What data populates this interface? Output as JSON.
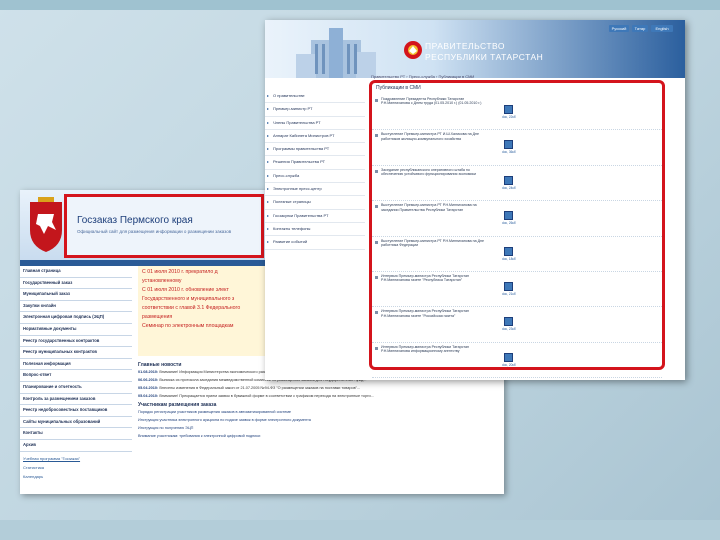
{
  "perm_site": {
    "title": "Госзаказ Пермского края",
    "subtitle": "Официальный сайт для размещения информации о размещении заказов",
    "sidebar": [
      "Главная страница",
      "Государственный заказ",
      "Муниципальный заказ",
      "Закупки онлайн",
      "Электронная цифровая подпись (ЭЦП)",
      "Нормативные документы",
      "Реестр государственных контрактов",
      "Реестр муниципальных контрактов",
      "Полезная информация",
      "Вопрос-ответ",
      "Планирование и отчетность",
      "Контроль за размещением заказов",
      "Реестр недобросовестных поставщиков",
      "Сайты муниципальных образований",
      "Контакты",
      "Архив"
    ],
    "side_extra": [
      "Учебная программа \"Госзаказ\"",
      "Статистика",
      "Календарь"
    ],
    "banner_lines": [
      "С 01 июля 2010 г. прекратило д",
      "установленному",
      "С 01 июля 2010 г. обновление элект",
      "Государственного и муниципального з",
      "соответствии с главой 3.1 Федерального",
      "размещения",
      "Семинар по электронным площадкам"
    ],
    "sec_news": "Главные новости",
    "news": [
      {
        "date": "01.08.2010:",
        "text": "Внимание! Информация Министерства экономического развития Пермского края о переходе на электронную форму размещения заказов..."
      },
      {
        "date": "06.06.2010:",
        "text": "Выписка из протокола заседания межведомственной комиссии по размещению заказов для государственных нужд..."
      },
      {
        "date": "05.04.2010:",
        "text": "Внесены изменения в Федеральный закон от 21.07.2005 №94-ФЗ \"О размещении заказов на поставки товаров\"..."
      },
      {
        "date": "05.04.2010:",
        "text": "Внимание! Прекращается прием заявок в бумажной форме в соответствии с графиком перехода на электронные торги..."
      }
    ],
    "sec_participants": "Участникам размещения заказа",
    "participants": [
      "Порядок регистрации участников размещения заказов в автоматизированной системе",
      "Инструкция участника электронного аукциона по подаче заявок в форме электронного документа",
      "Инструкция по получению ЭЦП",
      "Внимание участникам: требования к электронной цифровой подписи"
    ]
  },
  "tatar_site": {
    "gov_line1": "ПРАВИТЕЛЬСТВО",
    "gov_line2": "РЕСПУБЛИКИ ТАТАРСТАН",
    "top_buttons": [
      "Русский",
      "Татар",
      "English"
    ],
    "nav": [
      "О правительстве",
      "Премьер-министр РТ",
      "Члены Правительства РТ",
      "Аппарат Кабинета Министров РТ",
      "Программы правительства РТ",
      "Решения Правительства РТ",
      "Пресс-служба",
      "Электронные пресс-центр",
      "Полезные страницы",
      "Госзакупки Правительства РТ",
      "Контакты телефоны",
      "Развитие событий"
    ],
    "breadcrumb": "Правительство РТ › Пресс-служба › Публикации в СМИ",
    "page_title": "Публикации в СМИ",
    "items": [
      {
        "text": "Поздравление Президента Республики Татарстан Р.Н.Минниханова с Днем труда (01.05.2010 г.) (01.05.2010 г.)",
        "size": "doc, 22кб"
      },
      {
        "text": "Выступление Премьер-министра РТ И.Ш.Халикова на Дне работников жилищно-коммунального хозяйства",
        "size": "doc, 36кб"
      },
      {
        "text": "Заседание республиканского оперативного штаба по обеспечению устойчивого функционирования экономики",
        "size": "doc, 24кб"
      },
      {
        "text": "Выступление Премьер-министра РТ Р.Н.Минниханова на заседании Правительства Республики Татарстан",
        "size": "doc, 26кб"
      },
      {
        "text": "Выступление Премьер-министра РТ Р.Н.Минниханова на Дне работника Федерации",
        "size": "doc, 18кб"
      },
      {
        "text": "Интервью Премьер-министра Республики Татарстан Р.Н.Минниханова газете \"Республика Татарстан\"",
        "size": "doc, 21кб"
      },
      {
        "text": "Интервью Премьер-министра Республики Татарстан Р.Н.Минниханова газете \"Российская газета\"",
        "size": "doc, 23кб"
      },
      {
        "text": "Интервью Премьер-министра Республики Татарстан Р.Н.Минниханова информационному агентству",
        "size": "doc, 20кб"
      }
    ]
  }
}
